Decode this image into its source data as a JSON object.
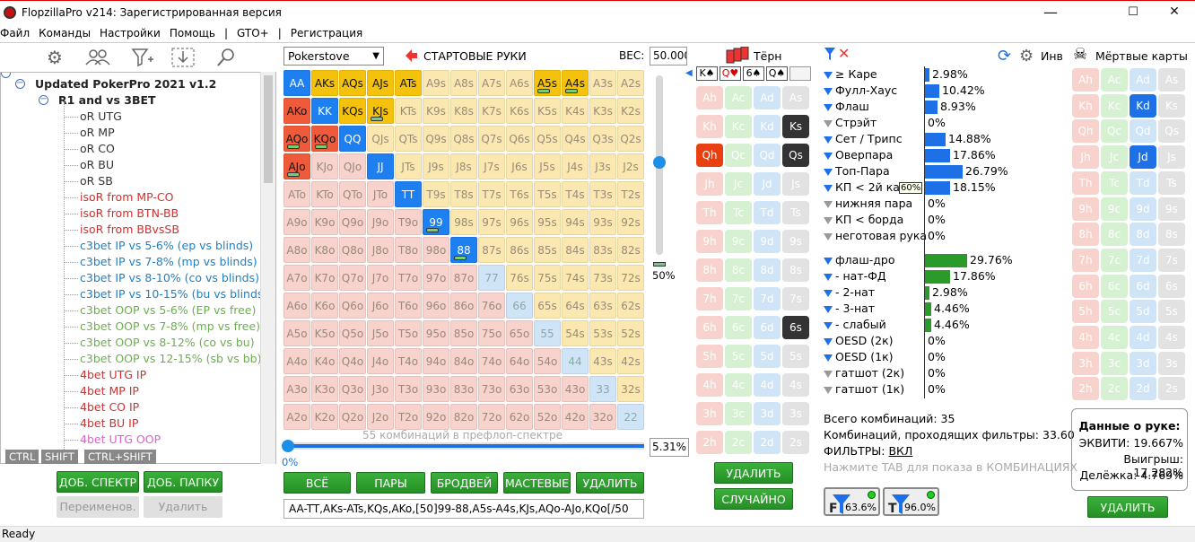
{
  "window": {
    "title": "FlopzillaPro v214: Зарегистрированная версия",
    "min": "—",
    "max": "☐",
    "close": "✕"
  },
  "menu": [
    "Файл",
    "Команды",
    "Настройки",
    "Помощь",
    "|",
    "GTO+",
    "|",
    "Регистрация"
  ],
  "tree": {
    "root": "Updated PokerPro 2021 v1.2",
    "folder": "R1 and vs 3BET",
    "items": [
      {
        "label": "oR UTG",
        "color": "#333333"
      },
      {
        "label": "oR MP",
        "color": "#333333"
      },
      {
        "label": "oR CO",
        "color": "#333333"
      },
      {
        "label": "oR BU",
        "color": "#333333"
      },
      {
        "label": "oR SB",
        "color": "#333333"
      },
      {
        "label": "isoR from MP-CO",
        "color": "#d03030"
      },
      {
        "label": "isoR from BTN-BB",
        "color": "#d03030"
      },
      {
        "label": "isoR from BBvsSB",
        "color": "#d03030"
      },
      {
        "label": "c3bet IP vs 5-6% (ep vs blinds)",
        "color": "#1c7fc8"
      },
      {
        "label": "c3bet IP vs 7-8% (mp vs blinds)",
        "color": "#1c7fc8"
      },
      {
        "label": "c3bet IP vs 8-10% (co vs blinds)",
        "color": "#1c7fc8"
      },
      {
        "label": "c3bet IP vs 10-15% (bu vs blinds)",
        "color": "#1c7fc8"
      },
      {
        "label": "c3bet OOP vs 5-6% (EP vs free)",
        "color": "#6ab04c"
      },
      {
        "label": "c3bet OOP vs 7-8% (mp vs free)",
        "color": "#6ab04c"
      },
      {
        "label": "c3bet OOP vs 8-12% (co vs bu)",
        "color": "#6ab04c"
      },
      {
        "label": "c3bet OOP vs 12-15% (sb vs bb)",
        "color": "#6ab04c"
      },
      {
        "label": "4bet UTG IP",
        "color": "#d03030"
      },
      {
        "label": "4bet MP IP",
        "color": "#d03030"
      },
      {
        "label": "4bet CO IP",
        "color": "#d03030"
      },
      {
        "label": "4bet BU IP",
        "color": "#d03030"
      },
      {
        "label": "4bet UTG OOP",
        "color": "#e060d0"
      }
    ]
  },
  "hotkeys": [
    "CTRL",
    "SHIFT",
    "CTRL+SHIFT"
  ],
  "left_buttons": {
    "add_range": "ДОБ. СПЕКТР",
    "add_folder": "ДОБ. ПАПКУ",
    "rename": "Переименов.",
    "delete": "Удалить"
  },
  "range": {
    "dropdown": "Pokerstove",
    "title": "СТАРТОВЫЕ РУКИ",
    "weight_label": "ВЕС:",
    "weight_value": "50.000",
    "slider_pct": "50%",
    "combos_text": "55 комбинаций в префлоп-спектре",
    "progress_left": "0%",
    "progress_right": "5.31%",
    "buttons": [
      "ВСЁ",
      "ПАРЫ",
      "БРОДВЕЙ",
      "МАСТЕВЫЕ",
      "УДАЛИТЬ"
    ],
    "text": "AA-TT,AKs-ATs,KQs,AKo,[50]99-88,A5s-A4s,KJs,AQo-AJo,KQo[/50"
  },
  "hands": [
    [
      "AA",
      "AKs",
      "AQs",
      "AJs",
      "ATs",
      "A9s",
      "A8s",
      "A7s",
      "A6s",
      "A5s",
      "A4s",
      "A3s",
      "A2s"
    ],
    [
      "AKo",
      "KK",
      "KQs",
      "KJs",
      "KTs",
      "K9s",
      "K8s",
      "K7s",
      "K6s",
      "K5s",
      "K4s",
      "K3s",
      "K2s"
    ],
    [
      "AQo",
      "KQo",
      "QQ",
      "QJs",
      "QTs",
      "Q9s",
      "Q8s",
      "Q7s",
      "Q6s",
      "Q5s",
      "Q4s",
      "Q3s",
      "Q2s"
    ],
    [
      "AJo",
      "KJo",
      "QJo",
      "JJ",
      "JTs",
      "J9s",
      "J8s",
      "J7s",
      "J6s",
      "J5s",
      "J4s",
      "J3s",
      "J2s"
    ],
    [
      "ATo",
      "KTo",
      "QTo",
      "JTo",
      "TT",
      "T9s",
      "T8s",
      "T7s",
      "T6s",
      "T5s",
      "T4s",
      "T3s",
      "T2s"
    ],
    [
      "A9o",
      "K9o",
      "Q9o",
      "J9o",
      "T9o",
      "99",
      "98s",
      "97s",
      "96s",
      "95s",
      "94s",
      "93s",
      "92s"
    ],
    [
      "A8o",
      "K8o",
      "Q8o",
      "J8o",
      "T8o",
      "98o",
      "88",
      "87s",
      "86s",
      "85s",
      "84s",
      "83s",
      "82s"
    ],
    [
      "A7o",
      "K7o",
      "Q7o",
      "J7o",
      "T7o",
      "97o",
      "87o",
      "77",
      "76s",
      "75s",
      "74s",
      "73s",
      "72s"
    ],
    [
      "A6o",
      "K6o",
      "Q6o",
      "J6o",
      "T6o",
      "96o",
      "86o",
      "76o",
      "66",
      "65s",
      "64s",
      "63s",
      "62s"
    ],
    [
      "A5o",
      "K5o",
      "Q5o",
      "J5o",
      "T5o",
      "95o",
      "85o",
      "75o",
      "65o",
      "55",
      "54s",
      "53s",
      "52s"
    ],
    [
      "A4o",
      "K4o",
      "Q4o",
      "J4o",
      "T4o",
      "94o",
      "84o",
      "74o",
      "64o",
      "54o",
      "44",
      "43s",
      "42s"
    ],
    [
      "A3o",
      "K3o",
      "Q3o",
      "J3o",
      "T3o",
      "93o",
      "83o",
      "73o",
      "63o",
      "53o",
      "43o",
      "33",
      "32s"
    ],
    [
      "A2o",
      "K2o",
      "Q2o",
      "J2o",
      "T2o",
      "92o",
      "82o",
      "72o",
      "62o",
      "52o",
      "42o",
      "32o",
      "22"
    ]
  ],
  "selected_hands": [
    "AA",
    "AKs",
    "AQs",
    "AJs",
    "ATs",
    "A5s",
    "A4s",
    "AKo",
    "KK",
    "KQs",
    "KJs",
    "AQo",
    "KQo",
    "QQ",
    "AJo",
    "JJ",
    "TT",
    "99",
    "88"
  ],
  "half_hands": [
    "99",
    "88",
    "AQo",
    "KQo",
    "AJo",
    "A5s",
    "A4s",
    "KJs"
  ],
  "board": {
    "title": "Тёрн",
    "cards": [
      "K♠",
      "Q♥",
      "6♠",
      "Q♠"
    ],
    "ranks": [
      "A",
      "K",
      "Q",
      "J",
      "T",
      "9",
      "8",
      "7",
      "6",
      "5",
      "4",
      "3",
      "2"
    ],
    "suits": [
      "h",
      "c",
      "d",
      "s"
    ],
    "selected": [
      "Ks",
      "Qh",
      "Qs",
      "6s"
    ],
    "delete": "УДАЛИТЬ",
    "random": "СЛУЧАЙНО"
  },
  "stats": {
    "rows": [
      {
        "label": "≥ Каре",
        "pct": "2.98%",
        "val": 2.98
      },
      {
        "label": "Фулл-Хаус",
        "pct": "10.42%",
        "val": 10.42
      },
      {
        "label": "Флаш",
        "pct": "8.93%",
        "val": 8.93
      },
      {
        "label": "Стрэйт",
        "pct": "0%",
        "val": 0
      },
      {
        "label": "Сет / Трипс",
        "pct": "14.88%",
        "val": 14.88
      },
      {
        "label": "Оверпара",
        "pct": "17.86%",
        "val": 17.86
      },
      {
        "label": "Топ-Пара",
        "pct": "26.79%",
        "val": 26.79
      },
      {
        "label": "КП < 2й кар",
        "pct": "18.15%",
        "val": 18.15
      },
      {
        "label": "нижняя пара",
        "pct": "0%",
        "val": 0
      },
      {
        "label": "КП < борда",
        "pct": "0%",
        "val": 0
      },
      {
        "label": "неготовая рука",
        "pct": "0%",
        "val": 0
      }
    ],
    "badge": "60%",
    "draws": [
      {
        "label": "флаш-дро",
        "pct": "29.76%",
        "val": 29.76
      },
      {
        "label": "- нат-ФД",
        "pct": "17.86%",
        "val": 17.86
      },
      {
        "label": "- 2-нат",
        "pct": "2.98%",
        "val": 2.98
      },
      {
        "label": "- 3-нат",
        "pct": "4.46%",
        "val": 4.46
      },
      {
        "label": "- слабый",
        "pct": "4.46%",
        "val": 4.46
      },
      {
        "label": "OESD (2к)",
        "pct": "0%",
        "val": 0
      },
      {
        "label": "OESD (1к)",
        "pct": "0%",
        "val": 0
      },
      {
        "label": "гатшот (2к)",
        "pct": "0%",
        "val": 0
      },
      {
        "label": "гатшот (1к)",
        "pct": "0%",
        "val": 0
      }
    ],
    "total": "Всего комбинаций: 35",
    "passing": "Комбинаций, проходящих фильтры: 33.60",
    "filters_label": "ФИЛЬТРЫ:",
    "filters_value": "ВКЛ",
    "hint": "Нажмите TAB для показа в КОМБИНАЦИЯХ",
    "f_badge": "63.6%",
    "t_badge": "96.0%"
  },
  "dead": {
    "inv": "Инв",
    "title": "Мёртвые карты",
    "selected": [
      "Kd",
      "Jd"
    ],
    "hand_title": "Данные о руке:",
    "equity": "ЭКВИТИ: 19.667%",
    "win": "Выигрыш: 17.282%",
    "tie": "Делёжка: 4.769%",
    "delete": "УДАЛИТЬ"
  },
  "status": "Ready"
}
